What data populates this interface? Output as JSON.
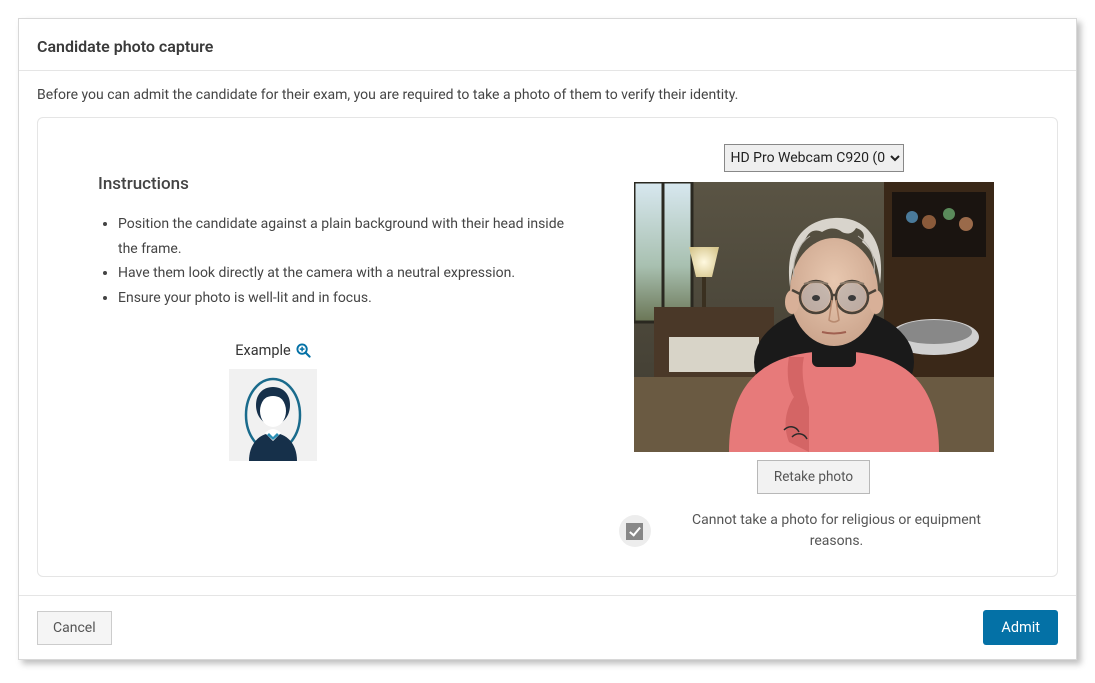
{
  "header": {
    "title": "Candidate photo capture"
  },
  "intro_text": "Before you can admit the candidate for their exam, you are required to take a photo of them to verify their identity.",
  "instructions": {
    "title": "Instructions",
    "items": [
      "Position the candidate against a plain background with their head inside the frame.",
      "Have them look directly at the camera with a neutral expression.",
      "Ensure your photo is well-lit and in focus."
    ],
    "example_label": "Example"
  },
  "camera": {
    "selected": "HD Pro Webcam C920 (0",
    "options": [
      "HD Pro Webcam C920 (0"
    ]
  },
  "buttons": {
    "retake": "Retake photo",
    "cancel": "Cancel",
    "admit": "Admit"
  },
  "religious": {
    "label": "Cannot take a photo for religious or equipment reasons.",
    "checked": true
  },
  "colors": {
    "primary": "#0471a6",
    "border": "#e5e5e5",
    "text": "#444"
  }
}
